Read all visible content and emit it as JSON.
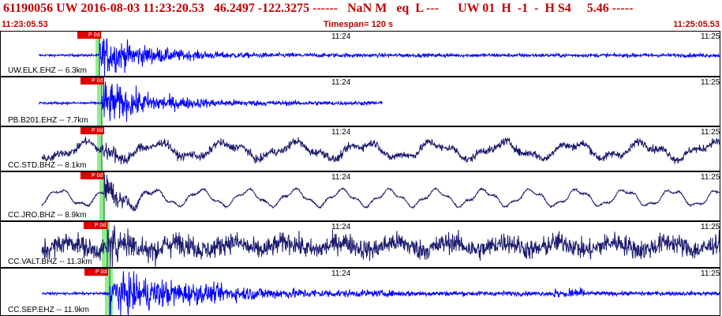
{
  "header": {
    "event_id": "61190056",
    "network": "UW",
    "datetime": "2016-08-03 11:23:20.53",
    "latitude": "46.2497",
    "longitude": "-122.3275",
    "depth": "------",
    "magnitude": "NaN M",
    "event_type": "eq",
    "event_class": "L ---",
    "source_info": "UW 01  H  -1  -  H S4",
    "extra": "5.46 -----",
    "line": "61190056 UW 2016-08-03 11:23:20.53   46.2497 -122.3275 ------   NaN M   eq  L ---      UW 01  H  -1  -  H S4     5.46 -----"
  },
  "subheader": {
    "start_time": "11:23:05.53",
    "timespan": "Timespan= 120 s",
    "end_time": "11:25:05.53"
  },
  "colors": {
    "header_text": "#c00000",
    "trace_blue": "#0000ff",
    "trace_dark": "#1a1a6e",
    "pick_red": "#e00000",
    "arrival_green": "#90ee90"
  },
  "panels": [
    {
      "station": "UW.ELK.EHZ -- 6.3km",
      "minute1": "11:24",
      "minute2": "11:25",
      "pick": "P 0d",
      "trace_color": "blue",
      "trace_style": "event",
      "ends_at": 1.0
    },
    {
      "station": "PB.B201.EHZ -- 7.7km",
      "minute1": "11:24",
      "minute2": "11:25",
      "pick": "P 0d",
      "trace_color": "blue",
      "trace_style": "event_truncated",
      "ends_at": 0.76
    },
    {
      "station": "CC.STD.BHZ -- 8.1km",
      "minute1": "11:24",
      "minute2": "11:25",
      "pick": "P 0d",
      "trace_color": "dark",
      "trace_style": "noisy_wave",
      "ends_at": 1.0
    },
    {
      "station": "CC.JRO.BHZ -- 8.9km",
      "minute1": "11:24",
      "minute2": "11:25",
      "pick": "P 0d",
      "trace_color": "dark",
      "trace_style": "smooth_wave",
      "ends_at": 1.0
    },
    {
      "station": "CC.VALT.BHZ -- 11.3km",
      "minute1": "11:24",
      "minute2": "11:25",
      "pick": "P 0d",
      "trace_color": "dark",
      "trace_style": "heavy_noise",
      "ends_at": 1.0
    },
    {
      "station": "CC.SEP.EHZ -- 11.9km",
      "minute1": "11:24",
      "minute2": "11:25",
      "pick": "P 0d",
      "trace_color": "blue",
      "trace_style": "event_late",
      "ends_at": 1.0
    }
  ]
}
